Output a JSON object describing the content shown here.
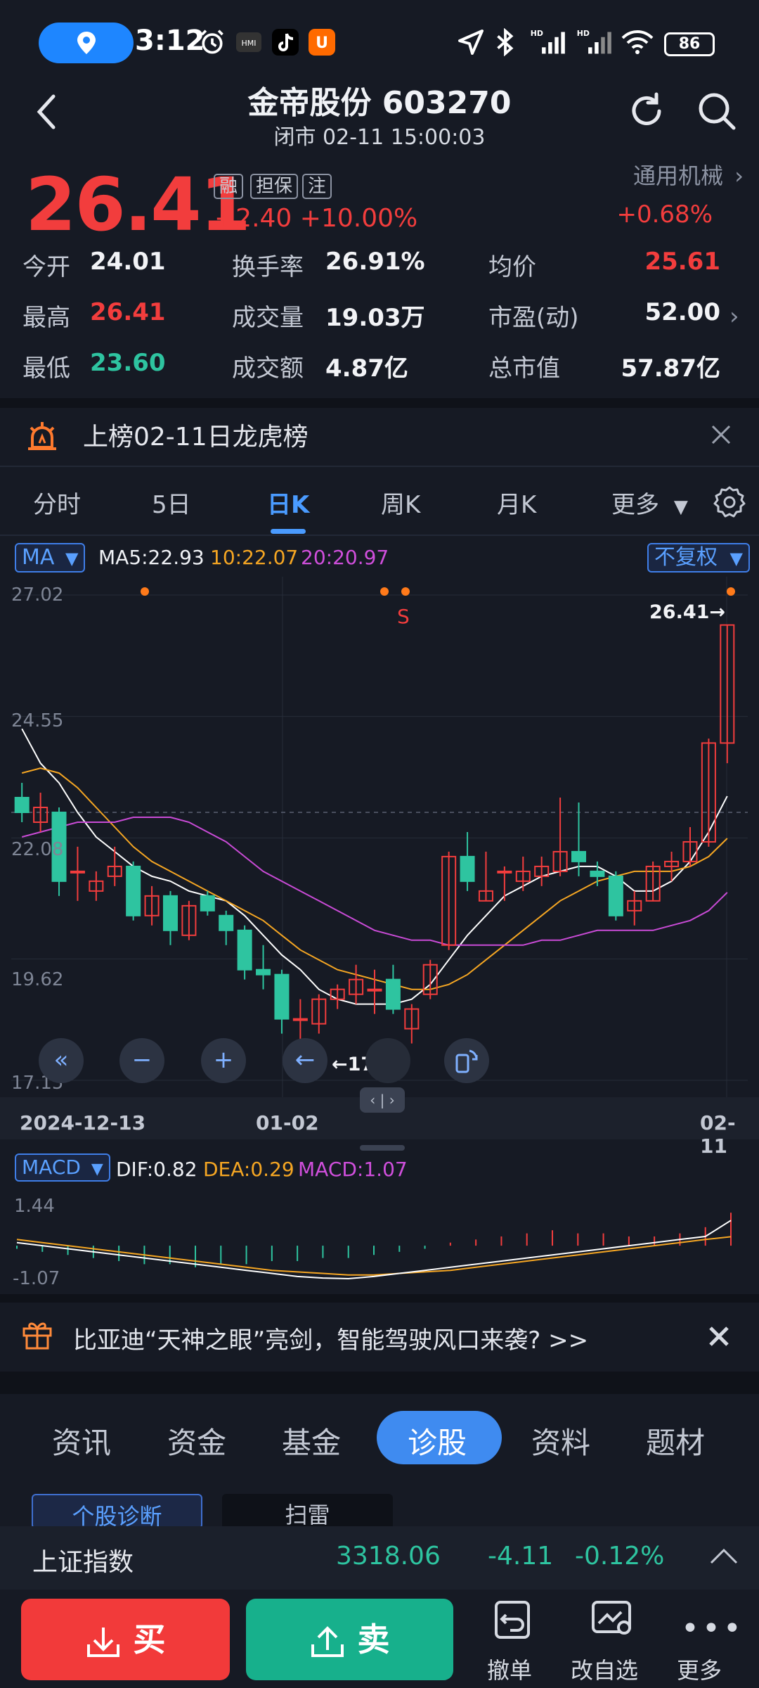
{
  "status_bar": {
    "time": "3:12",
    "battery": "86",
    "icons": [
      "location-icon",
      "alarm-icon",
      "hmi-icon",
      "tiktok-icon",
      "shop-icon",
      "navigation-icon",
      "bluetooth-icon",
      "signal-hd-icon",
      "signal-hd-icon",
      "wifi-icon"
    ],
    "hd_labels": [
      "HD",
      "HD"
    ]
  },
  "header": {
    "title": "金帝股份 603270",
    "subtitle": "闭市 02-11 15:00:03"
  },
  "quote": {
    "price": "26.41",
    "change": "+2.40",
    "change_pct": "+10.00%",
    "tags": [
      "融",
      "担保",
      "注"
    ],
    "sector": "通用机械",
    "sector_change": "+0.68%",
    "stats": [
      {
        "label": "今开",
        "value": "24.01"
      },
      {
        "label": "换手率",
        "value": "26.91%"
      },
      {
        "label": "均价",
        "value": "25.61"
      },
      {
        "label": "最高",
        "value": "26.41"
      },
      {
        "label": "成交量",
        "value": "19.03万"
      },
      {
        "label": "市盈(动)",
        "value": "52.00"
      },
      {
        "label": "最低",
        "value": "23.60"
      },
      {
        "label": "成交额",
        "value": "4.87亿"
      },
      {
        "label": "总市值",
        "value": "57.87亿"
      }
    ]
  },
  "banner": {
    "text": "上榜02-11日龙虎榜"
  },
  "chart_tabs": {
    "items": [
      "分时",
      "5日",
      "日K",
      "周K",
      "月K",
      "更多"
    ],
    "active": "日K"
  },
  "kline": {
    "ma_selector": "MA",
    "ma5": "MA5:22.93",
    "ma10": "10:22.07",
    "ma20": "20:20.97",
    "adjust_selector": "不复权",
    "y_labels": [
      "27.02",
      "24.55",
      "22.08",
      "19.62",
      "17.15"
    ],
    "x_labels": [
      "2024-12-13",
      "01-02",
      "02-11"
    ],
    "high_label": "26.41→",
    "low_label": "←17.76",
    "signal_label": "S",
    "scroll_handle": "‹ | ›"
  },
  "macd": {
    "selector": "MACD",
    "dif": "DIF:0.82",
    "dea": "DEA:0.29",
    "macd": "MACD:1.07",
    "y_labels": [
      "1.44",
      "-1.07"
    ]
  },
  "promo": {
    "text": "比亚迪“天神之眼”亮剑，智能驾驶风口来袭? >>"
  },
  "bottom_tabs": {
    "items": [
      "资讯",
      "资金",
      "基金",
      "诊股",
      "资料",
      "题材"
    ],
    "active": "诊股",
    "subtabs": [
      "个股诊断",
      "扫雷"
    ]
  },
  "index_bar": {
    "name": "上证指数",
    "value": "3318.06",
    "change": "-4.11",
    "change_pct": "-0.12%"
  },
  "trade_bar": {
    "buy": "买",
    "sell": "卖",
    "tools": [
      "撤单",
      "改自选",
      "更多"
    ]
  },
  "colors": {
    "up": "#f23d3d",
    "down": "#2ec4a0",
    "accent": "#4a9bff",
    "ma5": "#ffffff",
    "ma10": "#f5a623",
    "ma20": "#c94bd6"
  },
  "chart_data": {
    "type": "candlestick",
    "x_range": [
      "2024-12-13",
      "02-11"
    ],
    "ylim": [
      17.15,
      27.02
    ],
    "y_ticks": [
      27.02,
      24.55,
      22.08,
      19.62,
      17.15
    ],
    "candles": [
      {
        "o": 22.9,
        "c": 22.6,
        "h": 23.2,
        "l": 22.4
      },
      {
        "o": 22.4,
        "c": 22.7,
        "h": 23.0,
        "l": 22.2
      },
      {
        "o": 22.6,
        "c": 21.2,
        "h": 22.7,
        "l": 20.9
      },
      {
        "o": 21.4,
        "c": 21.4,
        "h": 21.9,
        "l": 20.8
      },
      {
        "o": 21.0,
        "c": 21.2,
        "h": 21.4,
        "l": 20.8
      },
      {
        "o": 21.3,
        "c": 21.5,
        "h": 21.9,
        "l": 21.1
      },
      {
        "o": 21.5,
        "c": 20.5,
        "h": 21.6,
        "l": 20.4
      },
      {
        "o": 20.5,
        "c": 20.9,
        "h": 21.1,
        "l": 20.3
      },
      {
        "o": 20.9,
        "c": 20.2,
        "h": 21.0,
        "l": 19.9
      },
      {
        "o": 20.1,
        "c": 20.7,
        "h": 20.8,
        "l": 20.0
      },
      {
        "o": 20.9,
        "c": 20.6,
        "h": 21.0,
        "l": 20.5
      },
      {
        "o": 20.5,
        "c": 20.2,
        "h": 20.6,
        "l": 19.9
      },
      {
        "o": 20.2,
        "c": 19.4,
        "h": 20.3,
        "l": 19.2
      },
      {
        "o": 19.4,
        "c": 19.3,
        "h": 19.9,
        "l": 19.0
      },
      {
        "o": 19.3,
        "c": 18.4,
        "h": 19.4,
        "l": 18.1
      },
      {
        "o": 18.4,
        "c": 18.4,
        "h": 18.8,
        "l": 17.76
      },
      {
        "o": 18.3,
        "c": 18.8,
        "h": 18.9,
        "l": 18.1
      },
      {
        "o": 18.8,
        "c": 19.0,
        "h": 19.1,
        "l": 18.6
      },
      {
        "o": 18.9,
        "c": 19.2,
        "h": 19.5,
        "l": 18.7
      },
      {
        "o": 19.0,
        "c": 19.0,
        "h": 19.4,
        "l": 18.5
      },
      {
        "o": 19.2,
        "c": 18.6,
        "h": 19.5,
        "l": 18.5
      },
      {
        "o": 18.2,
        "c": 18.6,
        "h": 18.7,
        "l": 17.9
      },
      {
        "o": 18.9,
        "c": 19.5,
        "h": 19.6,
        "l": 18.8
      },
      {
        "o": 19.9,
        "c": 21.7,
        "h": 21.8,
        "l": 19.8
      },
      {
        "o": 21.7,
        "c": 21.2,
        "h": 22.2,
        "l": 21.0
      },
      {
        "o": 20.8,
        "c": 21.0,
        "h": 21.8,
        "l": 20.8
      },
      {
        "o": 21.4,
        "c": 21.4,
        "h": 21.5,
        "l": 20.8
      },
      {
        "o": 21.2,
        "c": 21.4,
        "h": 21.7,
        "l": 21.0
      },
      {
        "o": 21.3,
        "c": 21.5,
        "h": 21.7,
        "l": 21.1
      },
      {
        "o": 21.4,
        "c": 21.8,
        "h": 22.9,
        "l": 21.3
      },
      {
        "o": 21.8,
        "c": 21.6,
        "h": 22.8,
        "l": 21.3
      },
      {
        "o": 21.4,
        "c": 21.3,
        "h": 21.6,
        "l": 21.1
      },
      {
        "o": 21.3,
        "c": 20.5,
        "h": 21.4,
        "l": 20.4
      },
      {
        "o": 20.6,
        "c": 20.8,
        "h": 21.0,
        "l": 20.3
      },
      {
        "o": 20.8,
        "c": 21.5,
        "h": 21.6,
        "l": 20.8
      },
      {
        "o": 21.5,
        "c": 21.6,
        "h": 21.8,
        "l": 21.2
      },
      {
        "o": 21.6,
        "c": 22.0,
        "h": 22.3,
        "l": 21.5
      },
      {
        "o": 22.0,
        "c": 24.01,
        "h": 24.1,
        "l": 21.9
      },
      {
        "o": 24.01,
        "c": 26.41,
        "h": 26.41,
        "l": 23.6
      }
    ],
    "series": [
      {
        "name": "MA5",
        "values": [
          24.3,
          23.6,
          23.2,
          22.6,
          22.1,
          21.8,
          21.5,
          21.3,
          21.2,
          21.0,
          20.9,
          20.8,
          20.5,
          20.1,
          19.7,
          19.4,
          19.0,
          18.8,
          18.7,
          18.7,
          18.7,
          18.8,
          19.1,
          19.6,
          20.1,
          20.5,
          20.9,
          21.1,
          21.3,
          21.4,
          21.5,
          21.5,
          21.3,
          21.0,
          21.0,
          21.2,
          21.6,
          22.2,
          22.93
        ]
      },
      {
        "name": "MA10",
        "values": [
          23.4,
          23.5,
          23.4,
          23.1,
          22.7,
          22.3,
          21.9,
          21.6,
          21.4,
          21.2,
          21.0,
          20.8,
          20.6,
          20.4,
          20.1,
          19.8,
          19.6,
          19.4,
          19.3,
          19.2,
          19.1,
          19.0,
          19.0,
          19.1,
          19.3,
          19.6,
          19.9,
          20.2,
          20.5,
          20.8,
          21.0,
          21.2,
          21.3,
          21.4,
          21.4,
          21.4,
          21.5,
          21.7,
          22.07
        ]
      },
      {
        "name": "MA20",
        "values": [
          22.1,
          22.2,
          22.3,
          22.4,
          22.4,
          22.4,
          22.5,
          22.5,
          22.5,
          22.4,
          22.2,
          22.0,
          21.7,
          21.4,
          21.2,
          21.0,
          20.8,
          20.6,
          20.4,
          20.2,
          20.1,
          20.0,
          20.0,
          19.9,
          19.9,
          19.9,
          19.9,
          19.9,
          20.0,
          20.0,
          20.1,
          20.2,
          20.2,
          20.2,
          20.2,
          20.3,
          20.4,
          20.6,
          20.97
        ]
      }
    ],
    "macd": {
      "ylim": [
        -1.07,
        1.44
      ],
      "dif": [
        0.1,
        0.0,
        -0.1,
        -0.2,
        -0.3,
        -0.4,
        -0.5,
        -0.6,
        -0.7,
        -0.8,
        -0.9,
        -1.0,
        -1.05,
        -1.07,
        -1.0,
        -0.9,
        -0.8,
        -0.7,
        -0.6,
        -0.5,
        -0.4,
        -0.3,
        -0.2,
        -0.1,
        0.0,
        0.1,
        0.2,
        0.3,
        0.82
      ],
      "dea": [
        0.2,
        0.1,
        0.0,
        -0.1,
        -0.2,
        -0.3,
        -0.4,
        -0.5,
        -0.6,
        -0.7,
        -0.8,
        -0.85,
        -0.9,
        -0.95,
        -0.95,
        -0.9,
        -0.85,
        -0.8,
        -0.7,
        -0.6,
        -0.5,
        -0.4,
        -0.3,
        -0.2,
        -0.1,
        0.0,
        0.1,
        0.2,
        0.29
      ],
      "hist": [
        -0.1,
        -0.2,
        -0.3,
        -0.4,
        -0.5,
        -0.6,
        -0.6,
        -0.7,
        -0.6,
        -0.6,
        -0.5,
        -0.5,
        -0.4,
        -0.4,
        -0.3,
        -0.2,
        -0.1,
        0.1,
        0.2,
        0.3,
        0.4,
        0.5,
        0.4,
        0.4,
        0.3,
        0.3,
        0.4,
        0.6,
        1.07
      ]
    }
  }
}
